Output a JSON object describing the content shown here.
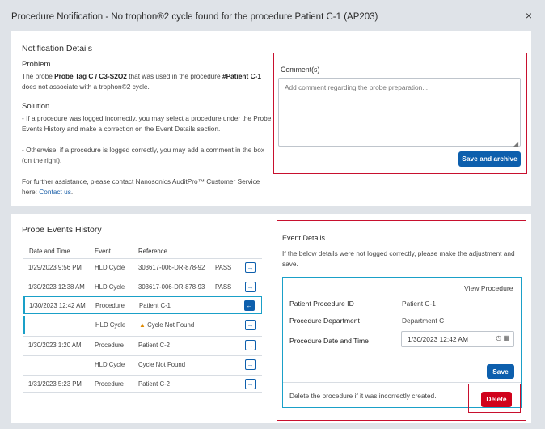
{
  "dialog": {
    "title": "Procedure Notification - No trophon®2 cycle found for the procedure Patient C-1 (AP203)",
    "close": "×"
  },
  "notification": {
    "heading": "Notification Details",
    "problem_heading": "Problem",
    "problem_pre": "The probe ",
    "problem_probe": "Probe Tag C / C3-S2O2",
    "problem_mid": " that was used in the procedure ",
    "problem_proc": "#Patient C-1",
    "problem_post": " does not associate with a trophon®2 cycle.",
    "solution_heading": "Solution",
    "solution_line1": "- If a procedure was logged incorrectly, you may select a procedure under the Probe Events History and make a correction on the Event Details section.",
    "solution_line2": "- Otherwise, if a procedure is logged correctly, you may add a comment in the box (on the right).",
    "assist_text": "For further assistance, please contact Nanosonics AuditPro™ Customer Service here: ",
    "assist_link": "Contact us",
    "assist_end": "."
  },
  "comments": {
    "label": "Comment(s)",
    "placeholder": "Add comment regarding the probe preparation...",
    "save_button": "Save and archive"
  },
  "history": {
    "heading": "Probe Events History",
    "columns": [
      "Date and Time",
      "Event",
      "Reference"
    ],
    "rows": [
      {
        "date": "1/29/2023 9:56 PM",
        "event": "HLD Cycle",
        "ref": "303617-006-DR-878-92",
        "status": "PASS",
        "warn": false,
        "selected": false
      },
      {
        "date": "1/30/2023 12:38 AM",
        "event": "HLD Cycle",
        "ref": "303617-006-DR-878-93",
        "status": "PASS",
        "warn": false,
        "selected": false
      },
      {
        "date": "1/30/2023 12:42 AM",
        "event": "Procedure",
        "ref": "Patient C-1",
        "status": "",
        "warn": false,
        "selected": true
      },
      {
        "date": "",
        "event": "HLD Cycle",
        "ref": "Cycle Not Found",
        "status": "",
        "warn": true,
        "selected": false
      },
      {
        "date": "1/30/2023 1:20 AM",
        "event": "Procedure",
        "ref": "Patient C-2",
        "status": "",
        "warn": false,
        "selected": false
      },
      {
        "date": "",
        "event": "HLD Cycle",
        "ref": "Cycle Not Found",
        "status": "",
        "warn": false,
        "selected": false
      },
      {
        "date": "1/31/2023 5:23 PM",
        "event": "Procedure",
        "ref": "Patient C-2",
        "status": "",
        "warn": false,
        "selected": false
      }
    ]
  },
  "event_details": {
    "heading": "Event Details",
    "description": "If the below details were not logged correctly, please make the adjustment and save.",
    "view_link": "View Procedure",
    "patient_id_label": "Patient Procedure ID",
    "patient_id_value": "Patient C-1",
    "department_label": "Procedure Department",
    "department_value": "Department C",
    "datetime_label": "Procedure Date and Time",
    "datetime_value": "1/30/2023 12:42 AM",
    "save_button": "Save",
    "delete_text": "Delete the procedure if it was incorrectly created.",
    "delete_button": "Delete"
  },
  "colors": {
    "primary": "#0d5fad",
    "danger": "#d0021b",
    "highlight": "#c8102e",
    "selection": "#1aa0c8",
    "warning": "#e08a00"
  },
  "icons": [
    "close-icon",
    "arrow-right-icon",
    "arrow-left-icon",
    "warning-icon",
    "clock-icon",
    "calendar-icon",
    "resize-grip-icon"
  ]
}
